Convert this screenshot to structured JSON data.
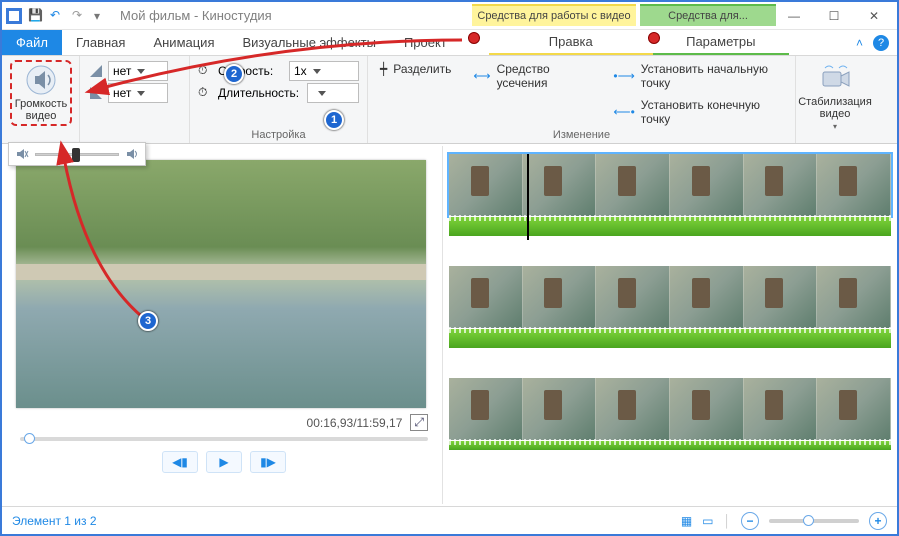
{
  "window": {
    "title": "Мой фильм - Киностудия"
  },
  "ctx_tabs": {
    "video": "Средства для работы с видео",
    "text": "Средства для..."
  },
  "tabs": {
    "file": "Файл",
    "home": "Главная",
    "anim": "Анимация",
    "vfx": "Визуальные эффекты",
    "project": "Проект",
    "edit": "Правка",
    "params": "Параметры"
  },
  "ribbon": {
    "volume": {
      "label": "Громкость\nвидео"
    },
    "fadein_label": "нет",
    "fadeout_label": "нет",
    "speed_label": "Скорость:",
    "speed_value": "1x",
    "duration_label": "Длительность:",
    "duration_value": "",
    "group_adjust": "Настройка",
    "split": "Разделить",
    "trim": "Средство усечения",
    "set_start": "Установить начальную точку",
    "set_end": "Установить конечную точку",
    "group_edit": "Изменение",
    "stabilize": "Стабилизация\nвидео"
  },
  "preview": {
    "time": "00:16,93/11:59,17"
  },
  "status": {
    "left": "Элемент 1 из 2"
  },
  "annotations": {
    "n1": "1",
    "n2": "2",
    "n3": "3"
  },
  "icons": {
    "speaker": "🔈",
    "speaker_mute": "🔇",
    "chevron": "▾",
    "help": "?",
    "undo": "↶",
    "redo": "↷",
    "save": "💾",
    "clock": "⏱",
    "split": "✂",
    "trim": "⇔",
    "dot_start": "•",
    "dot_end": "•",
    "expand": "⤢",
    "prev": "◀│",
    "play": "▶",
    "next": "│▶",
    "min": "—",
    "max": "☐",
    "close": "✕",
    "viewA": "▭",
    "viewB": "▭"
  }
}
